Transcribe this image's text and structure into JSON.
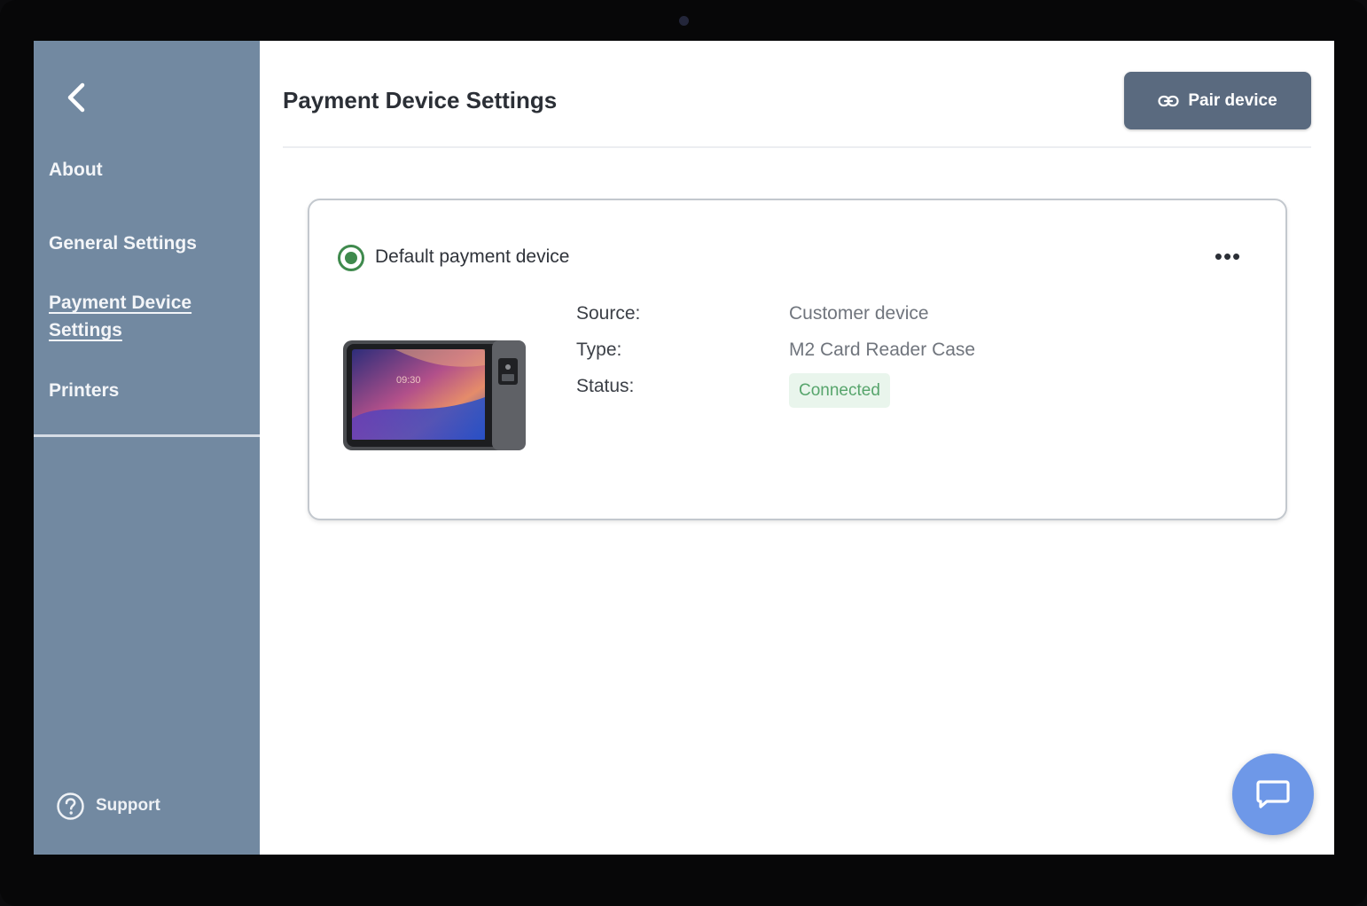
{
  "sidebar": {
    "items": [
      {
        "label": "About"
      },
      {
        "label": "General Settings"
      },
      {
        "label": "Payment Device Settings"
      },
      {
        "label": "Printers"
      }
    ],
    "support_label": "Support"
  },
  "header": {
    "title": "Payment Device Settings",
    "pair_button_label": "Pair device"
  },
  "device": {
    "default_label": "Default payment device",
    "rows": [
      {
        "label": "Source:",
        "value": "Customer device"
      },
      {
        "label": "Type:",
        "value": "M2 Card Reader Case"
      },
      {
        "label": "Status:",
        "value": "Connected"
      }
    ],
    "screen_time": "09:30",
    "more_label": "•••"
  },
  "colors": {
    "sidebar": "#7289a1",
    "pair_button": "#5a6a7f",
    "radio_accent": "#3f8a4d",
    "status_text": "#57a56c",
    "status_bg": "#e9f5ec",
    "chat_button": "#6e98e8"
  },
  "icons": {
    "back": "chevron-left-icon",
    "pair": "link-icon",
    "more": "ellipsis-icon",
    "support": "help-circle-icon",
    "chat": "chat-bubble-icon"
  }
}
